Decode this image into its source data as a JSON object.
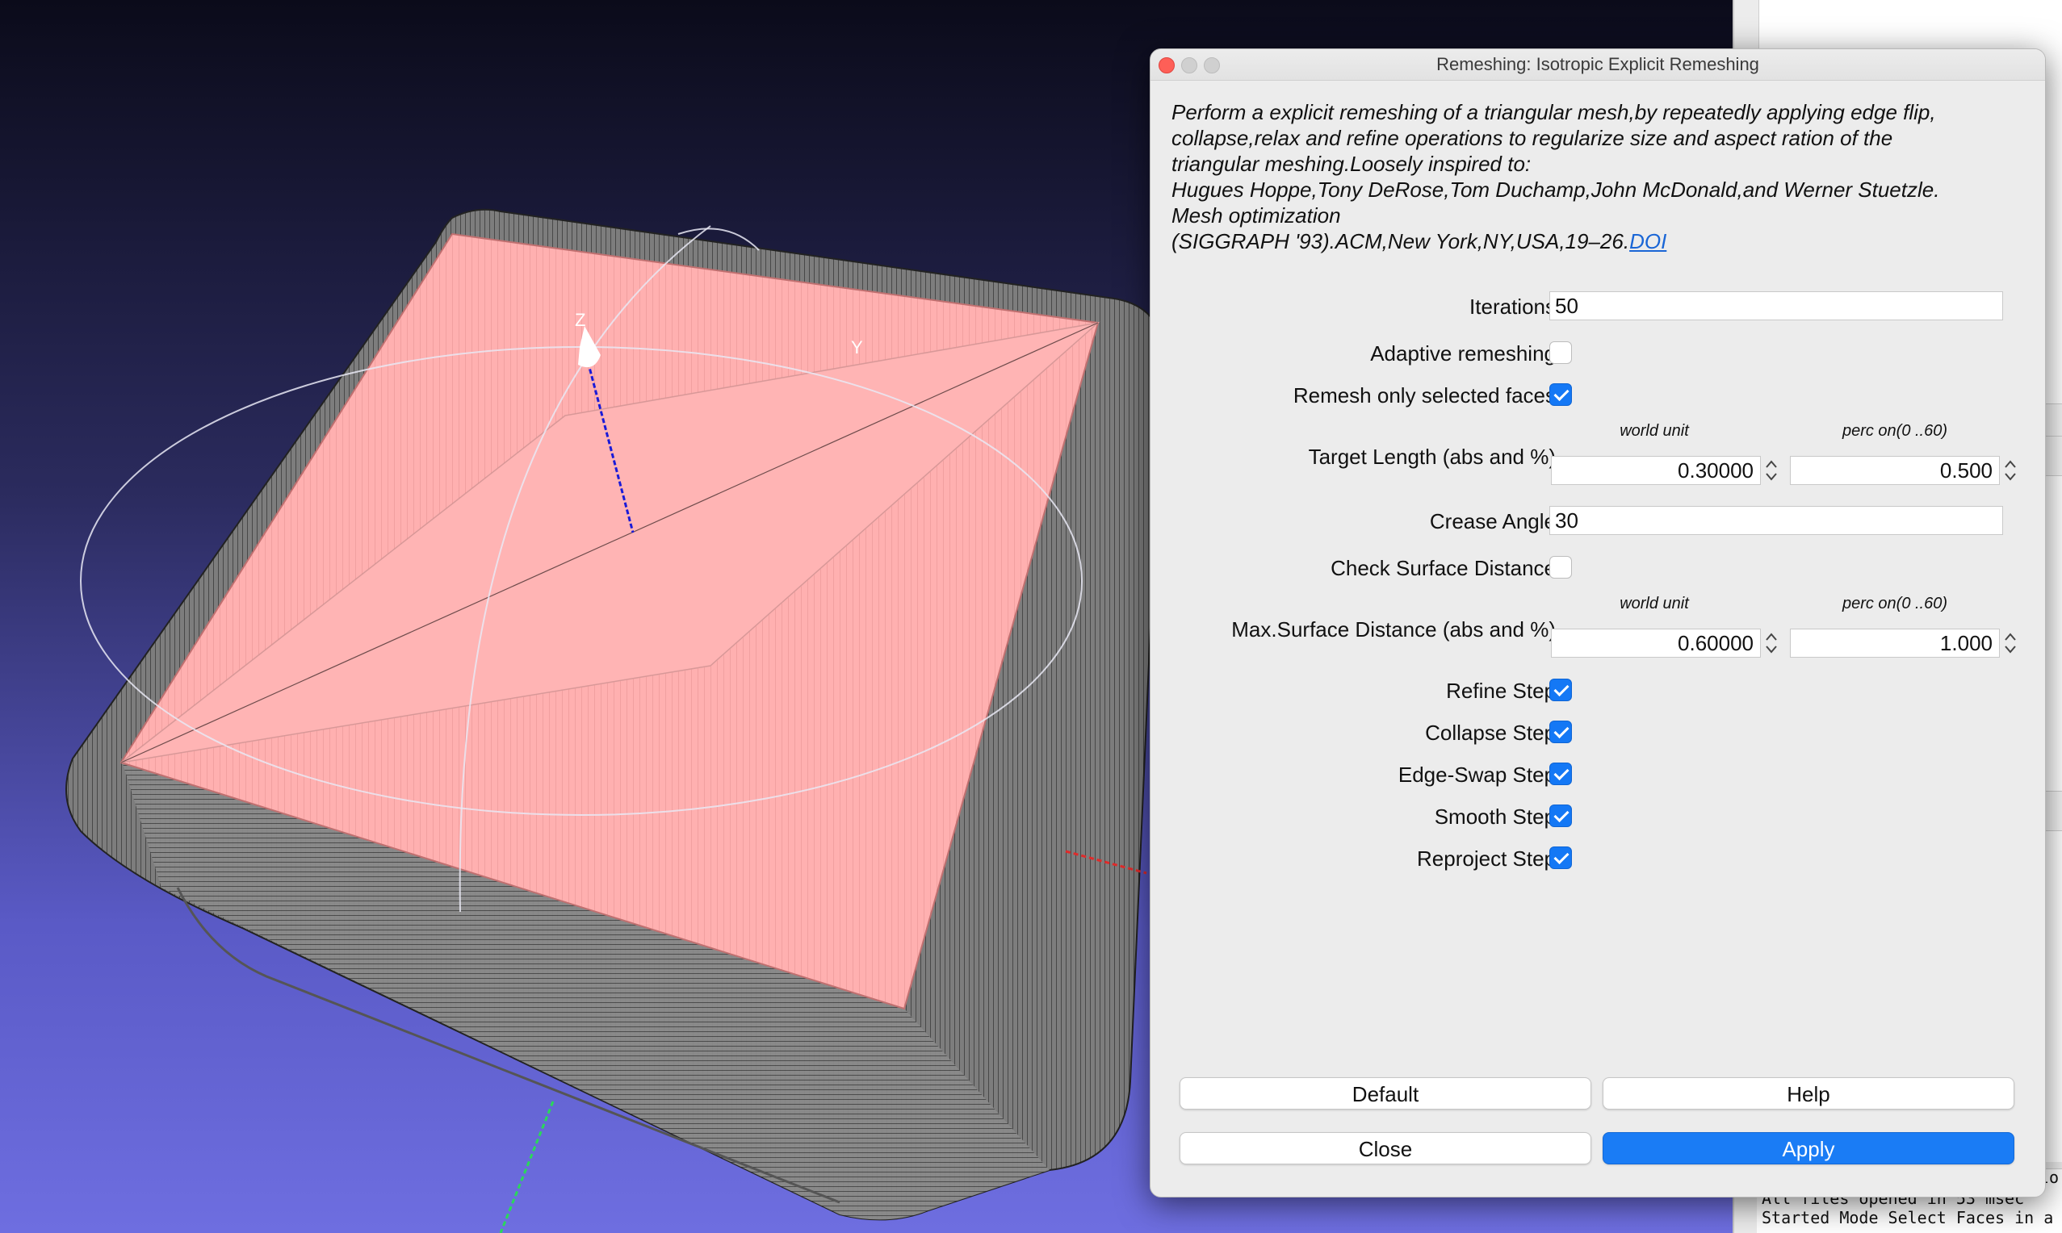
{
  "viewport": {
    "axis_labels": {
      "z": "Z",
      "y": "Y"
    },
    "colors": {
      "selected_faces": "#ffb4b4",
      "mesh_wire": "#444444",
      "bg_top": "#0b0b1a",
      "bg_bottom": "#6e6ee0"
    }
  },
  "dialog": {
    "title": "Remeshing: Isotropic Explicit Remeshing",
    "description_lines": [
      "Perform a explicit remeshing of a triangular mesh,by repeatedly applying edge flip,",
      "collapse,relax and refine operations to regularize size and aspect ration of the",
      "triangular meshing.Loosely inspired to:",
      "Hugues Hoppe,Tony DeRose,Tom Duchamp,John McDonald,and Werner Stuetzle.",
      "Mesh optimization",
      "(SIGGRAPH '93).ACM,New York,NY,USA,19–26."
    ],
    "doi_link": "DOI",
    "params": {
      "iterations": {
        "label": "Iterations",
        "value": "50"
      },
      "adaptive_remeshing": {
        "label": "Adaptive remeshing",
        "checked": false
      },
      "remesh_selected": {
        "label": "Remesh only selected faces",
        "checked": true
      },
      "target_length": {
        "label": "Target Length (abs and %)",
        "unit_label": "world unit",
        "perc_label": "perc on(0 ..60)",
        "abs_value": "0.30000",
        "perc_value": "0.500"
      },
      "crease_angle": {
        "label": "Crease Angle",
        "value": "30"
      },
      "check_surface_distance": {
        "label": "Check Surface Distance",
        "checked": false
      },
      "max_surface_distance": {
        "label": "Max.Surface Distance (abs and %)",
        "unit_label": "world unit",
        "perc_label": "perc on(0 ..60)",
        "abs_value": "0.60000",
        "perc_value": "1.000"
      },
      "refine_step": {
        "label": "Refine Step",
        "checked": true
      },
      "collapse_step": {
        "label": "Collapse Step",
        "checked": true
      },
      "edge_swap_step": {
        "label": "Edge-Swap Step",
        "checked": true
      },
      "smooth_step": {
        "label": "Smooth Step",
        "checked": true
      },
      "reproject_step": {
        "label": "Reproject Step",
        "checked": true
      }
    },
    "buttons": {
      "default": "Default",
      "help": "Help",
      "close": "Close",
      "apply": "Apply"
    },
    "colors": {
      "checkbox_on": "#1478f5",
      "apply_button": "#1a7cf5",
      "link": "#1a66d6"
    }
  },
  "log": {
    "partial_text": "lo",
    "lines": [
      "All files opened in 53 msec",
      "Started Mode Select Faces in a"
    ]
  }
}
